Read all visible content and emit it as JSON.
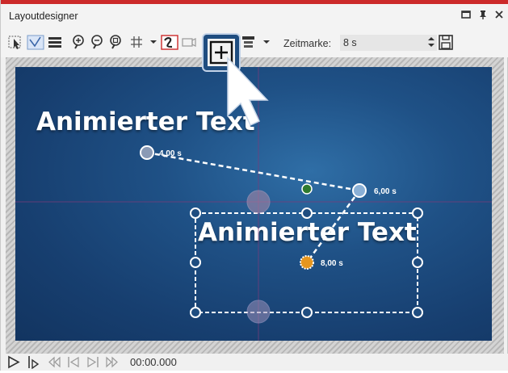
{
  "window": {
    "title": "Layoutdesigner",
    "accent_color": "#cc2a2a"
  },
  "toolbar": {
    "time_label": "Zeitmarke:",
    "time_value": "8 s",
    "icons": [
      "select-icon",
      "curve-icon",
      "layers-icon",
      "zoom-in-icon",
      "zoom-out-icon",
      "zoom-fit-icon",
      "grid-icon",
      "motion-path-icon",
      "screen-icon",
      "add-keyframe-icon",
      "align-icon",
      "save-icon"
    ]
  },
  "canvas": {
    "text_static": "Animierter Text",
    "text_animated": "Animierter Text",
    "background_color": "#1a4a7e",
    "keyframes": [
      {
        "label": "4,00 s"
      },
      {
        "label": "6,00 s"
      },
      {
        "label": "8,00 s"
      }
    ]
  },
  "statusbar": {
    "time": "00:00.000"
  }
}
